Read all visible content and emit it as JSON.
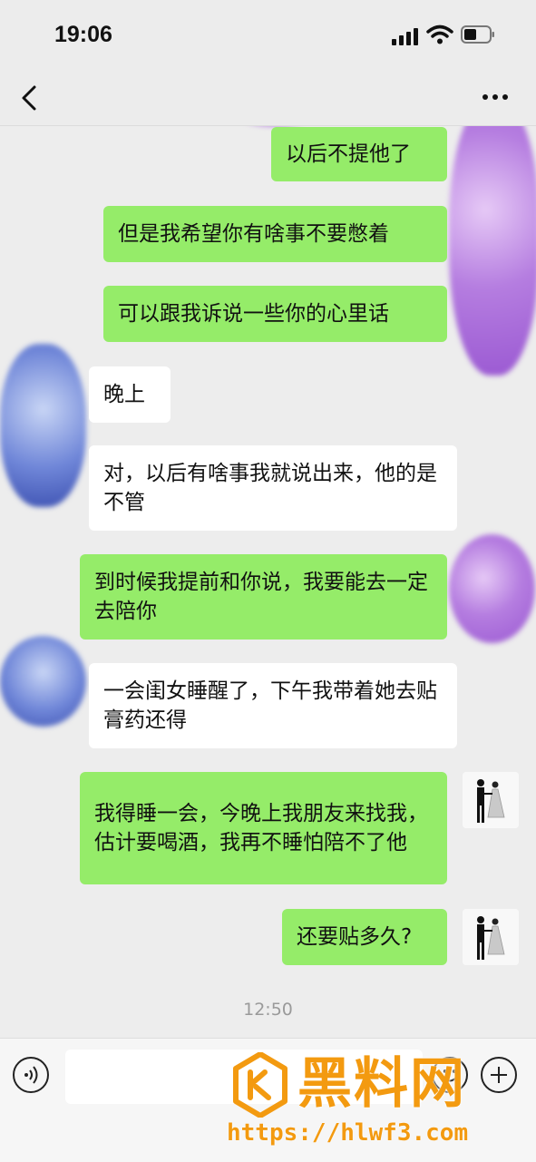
{
  "status_bar": {
    "time": "19:06"
  },
  "messages": [
    {
      "side": "out",
      "text": "以后不提他了",
      "avatar": false
    },
    {
      "side": "out",
      "text": "但是我希望你有啥事不要憋着",
      "avatar": false
    },
    {
      "side": "out",
      "text": "可以跟我诉说一些你的心里话",
      "avatar": false
    },
    {
      "side": "in",
      "text": "晚上"
    },
    {
      "side": "in",
      "text": "对，以后有啥事我就说出来，他的是不管"
    },
    {
      "side": "out",
      "text": "到时候我提前和你说，我要能去一定去陪你",
      "avatar": false
    },
    {
      "side": "in",
      "text": "一会闺女睡醒了，下午我带着她去贴膏药还得"
    },
    {
      "side": "out",
      "text": "我得睡一会，今晚上我朋友来找我，估计要喝酒，我再不睡怕陪不了他",
      "avatar": true
    },
    {
      "side": "out",
      "text": "还要贴多久?",
      "avatar": true
    }
  ],
  "timestamp": "12:50",
  "input": {
    "value": ""
  },
  "watermark": {
    "title": "黑料网",
    "url": "https://hlwf3.com"
  },
  "colors": {
    "outgoing_bubble": "#95ec69",
    "incoming_bubble": "#ffffff",
    "background": "#ededed",
    "watermark": "#f39a10"
  },
  "icons": [
    "back-icon",
    "more-icon",
    "voice-icon",
    "emoji-icon",
    "plus-icon"
  ]
}
